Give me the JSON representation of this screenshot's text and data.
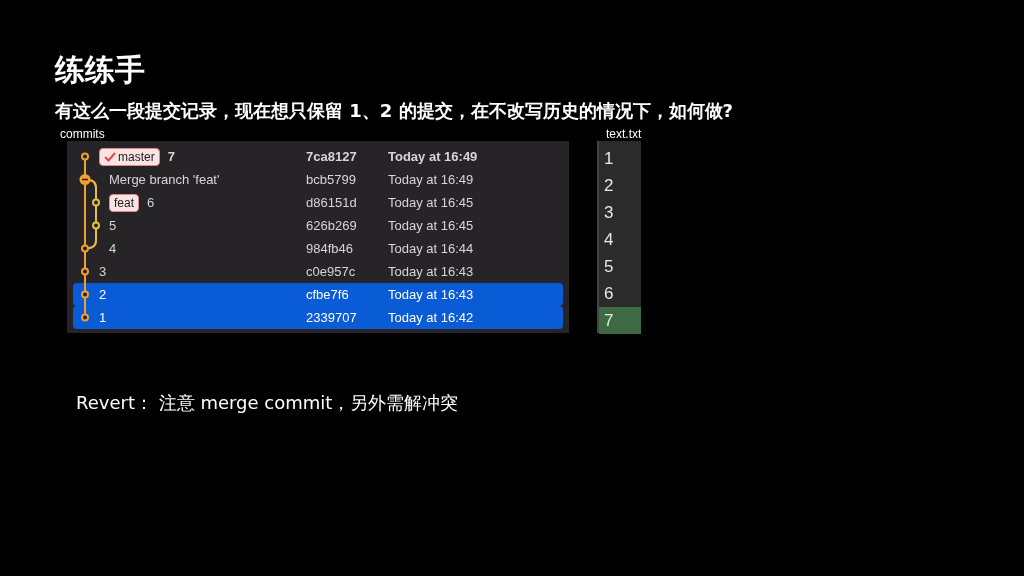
{
  "title": "练练手",
  "subtitle": "有这么一段提交记录，现在想只保留 1、2 的提交，在不改写历史的情况下，如何做?",
  "commits_panel": {
    "caption": "commits",
    "rows": [
      {
        "on_branch": false,
        "kind": "commit",
        "branch": {
          "label": "master",
          "checked": true
        },
        "message": "7",
        "hash": "7ca8127",
        "date": "Today at 16:49",
        "head": true,
        "selected": false
      },
      {
        "on_branch": false,
        "kind": "merge",
        "message": "Merge branch 'feat'",
        "hash": "bcb5799",
        "date": "Today at 16:49",
        "head": false,
        "selected": false
      },
      {
        "on_branch": true,
        "kind": "commit",
        "branch": {
          "label": "feat",
          "checked": false
        },
        "message": "6",
        "hash": "d86151d",
        "date": "Today at 16:45",
        "head": false,
        "selected": false
      },
      {
        "on_branch": true,
        "kind": "commit",
        "message": "5",
        "hash": "626b269",
        "date": "Today at 16:45",
        "head": false,
        "selected": false
      },
      {
        "on_branch": false,
        "kind": "fork",
        "message": "4",
        "hash": "984fb46",
        "date": "Today at 16:44",
        "head": false,
        "selected": false
      },
      {
        "on_branch": false,
        "kind": "commit",
        "message": "3",
        "hash": "c0e957c",
        "date": "Today at 16:43",
        "head": false,
        "selected": false
      },
      {
        "on_branch": false,
        "kind": "commit",
        "message": "2",
        "hash": "cfbe7f6",
        "date": "Today at 16:43",
        "head": false,
        "selected": true
      },
      {
        "on_branch": false,
        "kind": "commit",
        "message": "1",
        "hash": "2339707",
        "date": "Today at 16:42",
        "head": false,
        "selected": true
      }
    ]
  },
  "file_panel": {
    "caption": "text.txt",
    "lines": [
      {
        "text": "1",
        "highlighted": false
      },
      {
        "text": "2",
        "highlighted": false
      },
      {
        "text": "3",
        "highlighted": false
      },
      {
        "text": "4",
        "highlighted": false
      },
      {
        "text": "5",
        "highlighted": false
      },
      {
        "text": "6",
        "highlighted": false
      },
      {
        "text": "7",
        "highlighted": true
      }
    ]
  },
  "note": "Revert： 注意 merge commit，另外需解冲突"
}
